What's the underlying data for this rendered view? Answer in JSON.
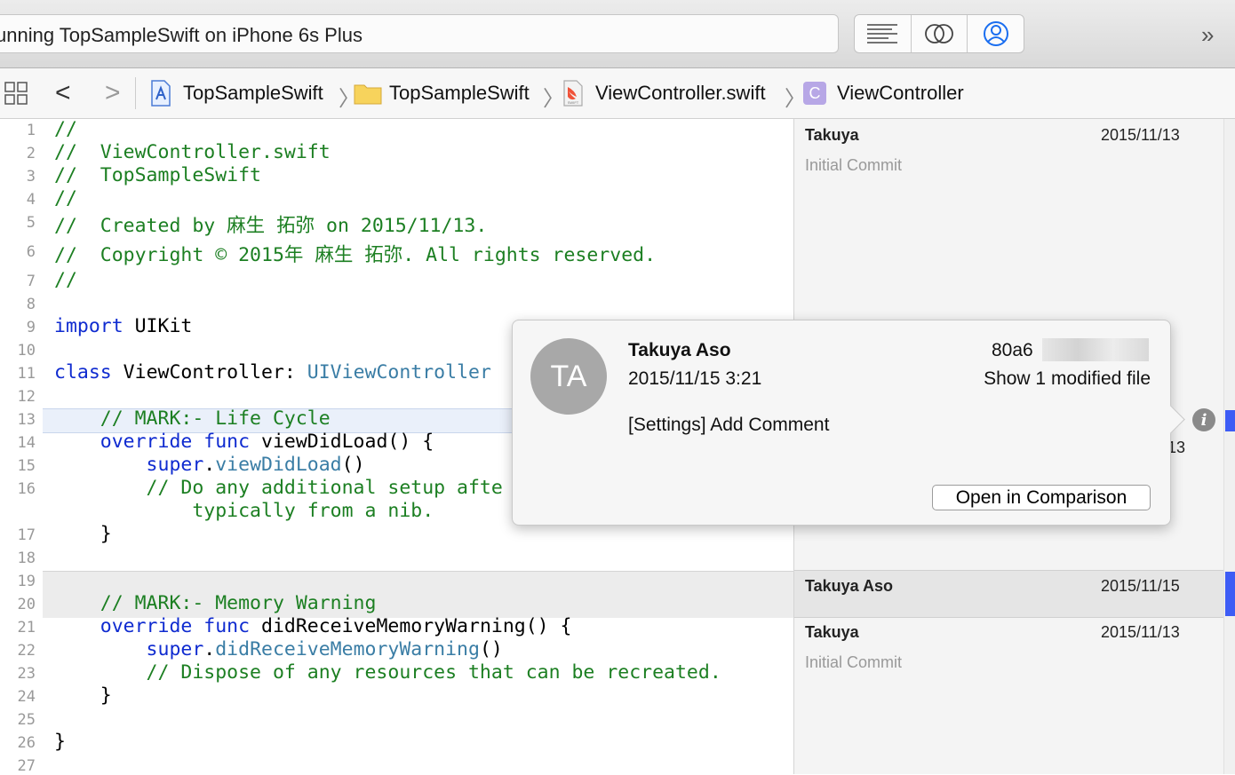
{
  "toolbar": {
    "status": "unning TopSampleSwift on iPhone 6s Plus",
    "segment_icons": [
      "standard-editor-icon",
      "assistant-editor-icon",
      "version-editor-icon"
    ],
    "more_label": "»"
  },
  "jumpbar": {
    "back": "<",
    "forward": ">",
    "crumbs": [
      "TopSampleSwift",
      "TopSampleSwift",
      "ViewController.swift",
      "ViewController"
    ],
    "class_glyph": "C",
    "swift_badge": "SWIFT"
  },
  "code_lines": [
    {
      "num": "1",
      "text": "//"
    },
    {
      "num": "2",
      "text": "//  ViewController.swift"
    },
    {
      "num": "3",
      "text": "//  TopSampleSwift"
    },
    {
      "num": "4",
      "text": "//"
    },
    {
      "num": "5",
      "text": "//  Created by 麻生 拓弥 on 2015/11/13."
    },
    {
      "num": "6",
      "text": "//  Copyright © 2015年 麻生 拓弥. All rights reserved."
    },
    {
      "num": "7",
      "text": "//"
    },
    {
      "num": "8",
      "text": ""
    },
    {
      "num": "9",
      "parts": [
        {
          "k": "import"
        },
        {
          "p": " UIKit"
        }
      ]
    },
    {
      "num": "10",
      "text": ""
    },
    {
      "num": "11",
      "parts": [
        {
          "k": "class"
        },
        {
          "p": " ViewController: "
        },
        {
          "t": "UIViewController"
        }
      ]
    },
    {
      "num": "12",
      "text": ""
    },
    {
      "num": "13",
      "text": "    // MARK:- Life Cycle"
    },
    {
      "num": "14",
      "parts": [
        {
          "k": "    override func"
        },
        {
          "p": " viewDidLoad() {"
        }
      ]
    },
    {
      "num": "15",
      "parts": [
        {
          "k": "        super"
        },
        {
          "p": "."
        },
        {
          "t": "viewDidLoad"
        },
        {
          "p": "()"
        }
      ]
    },
    {
      "num": "16",
      "text": "        // Do any additional setup afte"
    },
    {
      "num": "",
      "text": "            typically from a nib."
    },
    {
      "num": "17",
      "text": "    }"
    },
    {
      "num": "18",
      "text": ""
    },
    {
      "num": "19",
      "text": ""
    },
    {
      "num": "20",
      "text": "    // MARK:- Memory Warning"
    },
    {
      "num": "21",
      "parts": [
        {
          "k": "    override func"
        },
        {
          "p": " didReceiveMemoryWarning() {"
        }
      ]
    },
    {
      "num": "22",
      "parts": [
        {
          "k": "        super"
        },
        {
          "p": "."
        },
        {
          "t": "didReceiveMemoryWarning"
        },
        {
          "p": "()"
        }
      ]
    },
    {
      "num": "23",
      "text": "        // Dispose of any resources that can be recreated."
    },
    {
      "num": "24",
      "text": "    }"
    },
    {
      "num": "25",
      "text": ""
    },
    {
      "num": "26",
      "text": "}"
    },
    {
      "num": "27",
      "text": ""
    }
  ],
  "blame": [
    {
      "author": "Takuya",
      "date": "2015/11/13",
      "message": "Initial Commit"
    },
    {
      "author": "Takuya Aso",
      "date": "2015/11/15",
      "message": ""
    },
    {
      "author": "Takuya",
      "date": "2015/11/13",
      "message": "Initial Commit"
    }
  ],
  "blame_partial_date": "13",
  "popover": {
    "initials": "TA",
    "author": "Takuya Aso",
    "datetime": "2015/11/15 3:21",
    "hash_visible": "80a6",
    "modified": "Show 1 modified file",
    "message": "[Settings] Add Comment",
    "button": "Open in Comparison"
  },
  "colors": {
    "comment": "#1c7f22",
    "keyword": "#0f2bd0",
    "type": "#3a7da5",
    "accent": "#3d5cf5"
  }
}
